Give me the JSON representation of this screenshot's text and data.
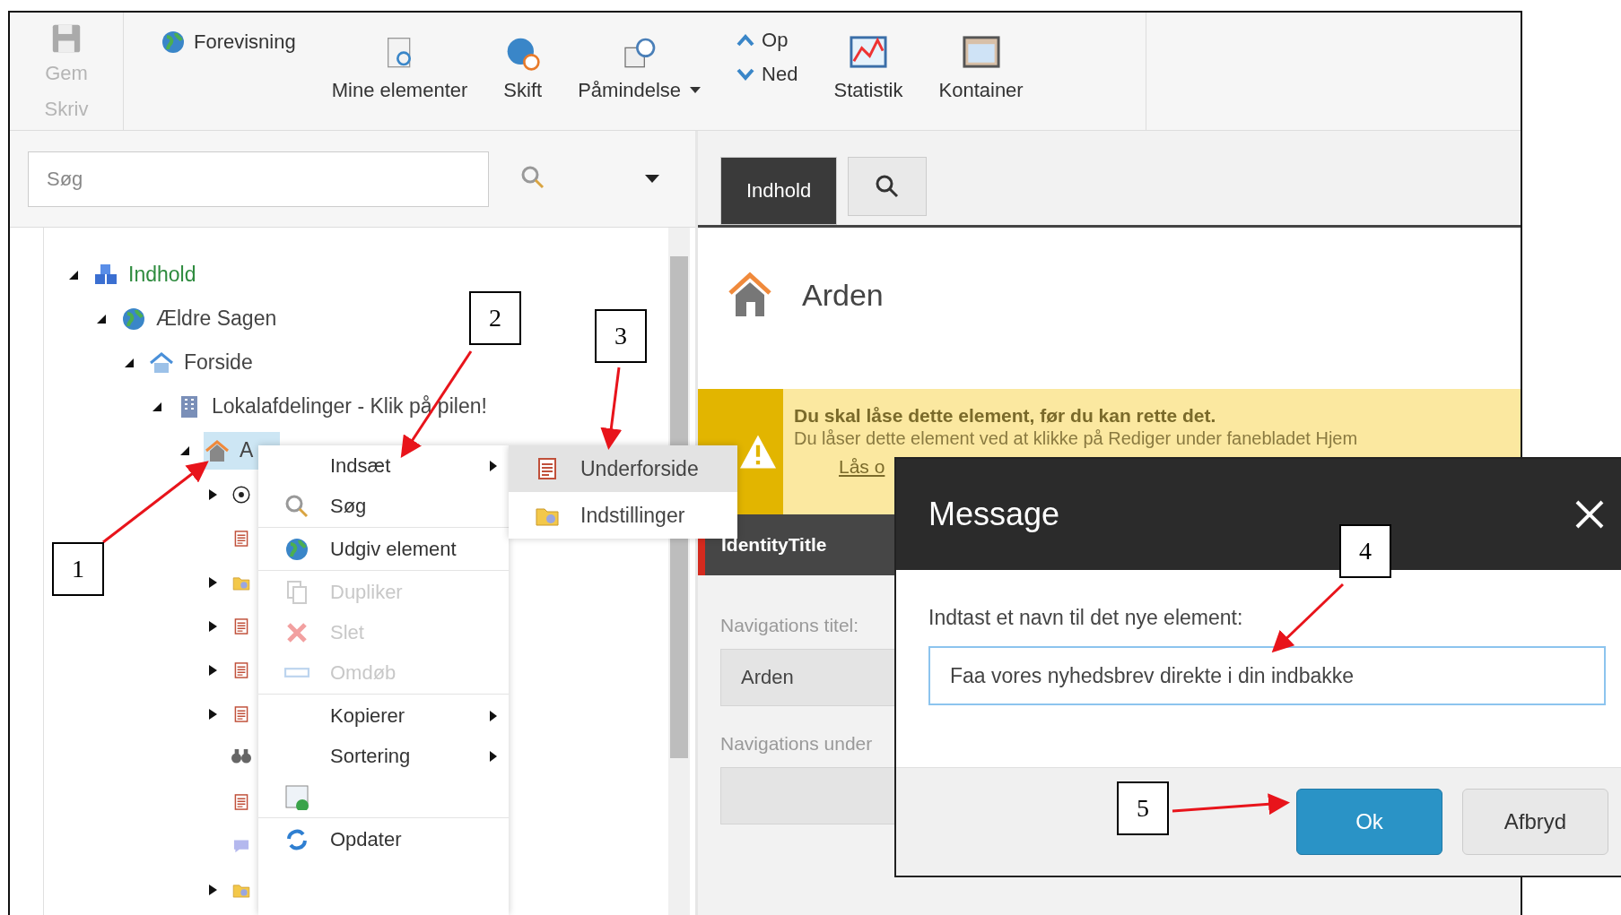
{
  "toolbar": {
    "save": [
      {
        "label": "Gem",
        "disabled": true
      },
      {
        "label": "Skriv",
        "disabled": true
      }
    ],
    "preview": "Forevisning",
    "buttons": [
      {
        "label": "Mine elementer",
        "dropdown": false
      },
      {
        "label": "Skift",
        "dropdown": false
      },
      {
        "label": "Påmindelse",
        "dropdown": true
      }
    ],
    "move": [
      "Op",
      "Ned"
    ],
    "tools": [
      "Statistik",
      "Kontainer"
    ]
  },
  "search": {
    "placeholder": "Søg"
  },
  "tree": [
    {
      "label": "Indhold",
      "expanded": true,
      "selected": false,
      "children": [
        {
          "label": "Ældre Sagen",
          "expanded": true,
          "selected": false,
          "children": [
            {
              "label": "Forside",
              "expanded": true,
              "selected": false,
              "children": [
                {
                  "label": "Lokalafdelinger - Klik på pilen!",
                  "expanded": true,
                  "selected": false,
                  "children": [
                    {
                      "label": "A",
                      "expanded": true,
                      "selected": true,
                      "children": [
                        {
                          "expanded": false,
                          "selected": false
                        },
                        {
                          "selected": false
                        },
                        {
                          "expanded": false,
                          "selected": false
                        },
                        {
                          "expanded": false,
                          "selected": false
                        },
                        {
                          "expanded": false,
                          "selected": false
                        },
                        {
                          "expanded": false,
                          "selected": false
                        },
                        {
                          "selected": false
                        },
                        {
                          "selected": false
                        },
                        {
                          "selected": false
                        },
                        {
                          "expanded": false,
                          "selected": false
                        }
                      ]
                    }
                  ]
                }
              ]
            }
          ]
        }
      ]
    }
  ],
  "context_menu": [
    {
      "kind": "item",
      "label": "Indsæt",
      "submenu": true,
      "disabled": false
    },
    {
      "kind": "item",
      "label": "Søg",
      "submenu": false,
      "disabled": false
    },
    {
      "kind": "separator"
    },
    {
      "kind": "item",
      "label": "Udgiv element",
      "submenu": false,
      "disabled": false
    },
    {
      "kind": "separator"
    },
    {
      "kind": "item",
      "label": "Dupliker",
      "submenu": false,
      "disabled": true
    },
    {
      "kind": "item",
      "label": "Slet",
      "submenu": false,
      "disabled": true
    },
    {
      "kind": "item",
      "label": "Omdøb",
      "submenu": false,
      "disabled": true
    },
    {
      "kind": "separator"
    },
    {
      "kind": "item",
      "label": "Kopierer",
      "submenu": true,
      "disabled": false
    },
    {
      "kind": "item",
      "label": "Sortering",
      "submenu": true,
      "disabled": false
    },
    {
      "kind": "icon"
    },
    {
      "kind": "separator"
    },
    {
      "kind": "item",
      "label": "Opdater",
      "submenu": false,
      "disabled": false
    }
  ],
  "submenu": [
    {
      "label": "Underforside",
      "selected": true
    },
    {
      "label": "Indstillinger",
      "selected": false
    }
  ],
  "editor": {
    "tabs": [
      {
        "kind": "text",
        "label": "Indhold",
        "selected": true
      },
      {
        "kind": "search",
        "selected": false
      }
    ],
    "title": "Arden",
    "warning": {
      "title": "Du skal låse dette element, før du kan rette det.",
      "text": "Du låser dette element ved at klikke på Rediger under fanebladet Hjem",
      "link": "Lås o"
    },
    "section": "IdentityTitle",
    "fields": [
      {
        "label": "Navigations titel:",
        "value": "Arden"
      },
      {
        "label": "Navigations under"
      }
    ]
  },
  "dialog": {
    "title": "Message",
    "prompt": "Indtast et navn til det nye element:",
    "value": "Faa vores nyhedsbrev direkte i din indbakke",
    "buttons": [
      {
        "label": "Ok",
        "primary": true
      },
      {
        "label": "Afbryd",
        "primary": false
      }
    ]
  },
  "annotations": [
    "1",
    "2",
    "3",
    "4",
    "5"
  ]
}
